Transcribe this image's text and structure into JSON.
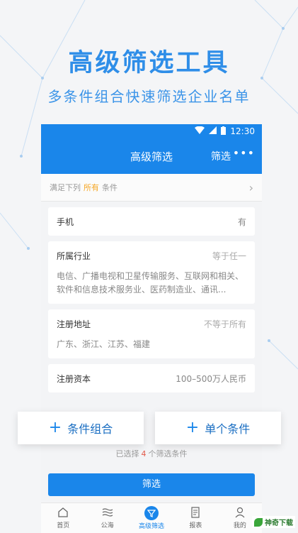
{
  "hero": {
    "title": "高级筛选工具",
    "subtitle": "多条件组合快速筛选企业名单"
  },
  "status": {
    "time": "12:30"
  },
  "appbar": {
    "title": "高级筛选",
    "filter": "筛选",
    "more": "•••"
  },
  "condition": {
    "prefix": "满足下列",
    "highlight": "所有",
    "suffix": "条件"
  },
  "filters": [
    {
      "label": "手机",
      "value": "有"
    },
    {
      "label": "所属行业",
      "value": "等于任一",
      "desc": "电信、广播电视和卫星传输服务、互联网和相关、软件和信息技术服务业、医药制造业、通讯..."
    },
    {
      "label": "注册地址",
      "value": "不等于所有",
      "desc": "广东、浙江、江苏、福建"
    },
    {
      "label": "注册资本",
      "value": "100–500万人民币"
    }
  ],
  "buttons": {
    "combo": "条件组合",
    "single": "单个条件"
  },
  "selected": {
    "prefix": "已选择",
    "count": "4",
    "suffix": "个筛选条件"
  },
  "submit": "筛选",
  "tabs": [
    {
      "label": "首页",
      "icon": "home-icon"
    },
    {
      "label": "公海",
      "icon": "waves-icon"
    },
    {
      "label": "高级筛选",
      "icon": "filter-icon"
    },
    {
      "label": "报表",
      "icon": "report-icon"
    },
    {
      "label": "我的",
      "icon": "user-icon"
    }
  ],
  "watermark": "神奇下载",
  "colors": {
    "accent": "#1a86ea",
    "highlight": "#f5a623",
    "count": "#e25a4a",
    "hero": "#2f8ee8"
  }
}
